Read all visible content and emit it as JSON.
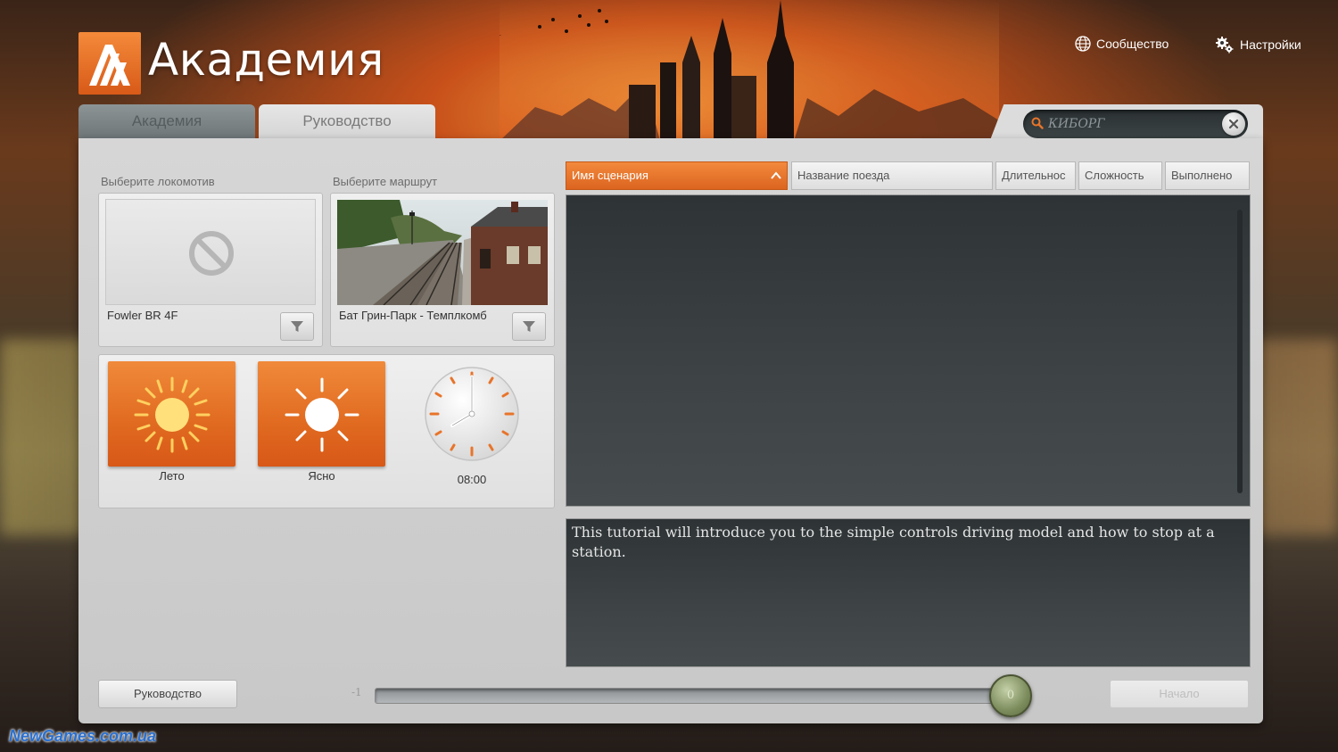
{
  "header": {
    "app_title": "Академия",
    "links": {
      "community": "Сообщество",
      "settings": "Настройки"
    }
  },
  "tabs": [
    {
      "label": "Академия",
      "active": false
    },
    {
      "label": "Руководство",
      "active": true
    }
  ],
  "search": {
    "value": "КИБОРГ"
  },
  "locomotive": {
    "section_label": "Выберите локомотив",
    "name": "Fowler BR 4F",
    "icon": "no-image-icon"
  },
  "route": {
    "section_label": "Выберите маршрут",
    "name": "Бат Грин-Парк - Темплкомб"
  },
  "environment": {
    "season": {
      "label": "Лето",
      "icon": "sun-icon"
    },
    "weather": {
      "label": "Ясно",
      "icon": "clear-sun-icon"
    },
    "time": {
      "label": "08:00"
    }
  },
  "scenario_table": {
    "columns": [
      {
        "label": "Имя сценария",
        "sorted": "asc"
      },
      {
        "label": "Название поезда"
      },
      {
        "label": "Длительнос"
      },
      {
        "label": "Сложность"
      },
      {
        "label": "Выполнено"
      }
    ],
    "rows": []
  },
  "description": "This tutorial will introduce you to the simple controls driving model and how to stop at a station.",
  "bottom": {
    "guide_button": "Руководство",
    "start_button": "Начало",
    "slider": {
      "min_label": "-1",
      "value": 0
    }
  },
  "watermark": "NewGames.com.ua",
  "colors": {
    "accent": "#e8742a",
    "panel": "#d0d0d0",
    "dark_list": "#3a4042",
    "knob": "#7c8c5c"
  }
}
